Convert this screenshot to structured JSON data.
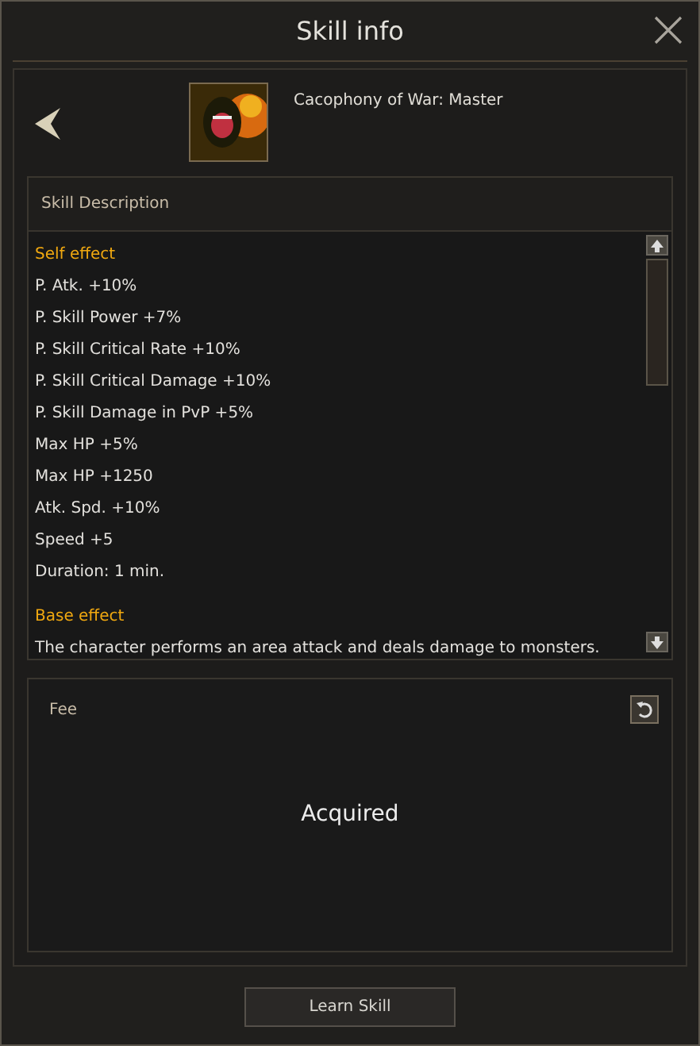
{
  "window": {
    "title": "Skill info"
  },
  "skill": {
    "name": "Cacophony of War: Master"
  },
  "description": {
    "title": "Skill Description",
    "lines": [
      {
        "kind": "heading",
        "text": "Self effect"
      },
      {
        "kind": "stat",
        "text": "P. Atk. +10%"
      },
      {
        "kind": "stat",
        "text": "P. Skill Power +7%"
      },
      {
        "kind": "stat",
        "text": "P. Skill Critical Rate +10%"
      },
      {
        "kind": "stat",
        "text": "P. Skill Critical Damage +10%"
      },
      {
        "kind": "stat",
        "text": "P. Skill Damage in PvP +5%"
      },
      {
        "kind": "stat",
        "text": "Max HP +5%"
      },
      {
        "kind": "stat",
        "text": "Max HP +1250"
      },
      {
        "kind": "stat",
        "text": "Atk. Spd. +10%"
      },
      {
        "kind": "stat",
        "text": "Speed +5"
      },
      {
        "kind": "stat",
        "text": "Duration: 1 min."
      },
      {
        "kind": "gap"
      },
      {
        "kind": "heading",
        "text": "Base effect"
      },
      {
        "kind": "stat",
        "text": "The character performs an area attack and deals damage to monsters."
      }
    ]
  },
  "fee": {
    "title": "Fee",
    "status": "Acquired"
  },
  "buttons": [
    "Learn Skill"
  ]
}
